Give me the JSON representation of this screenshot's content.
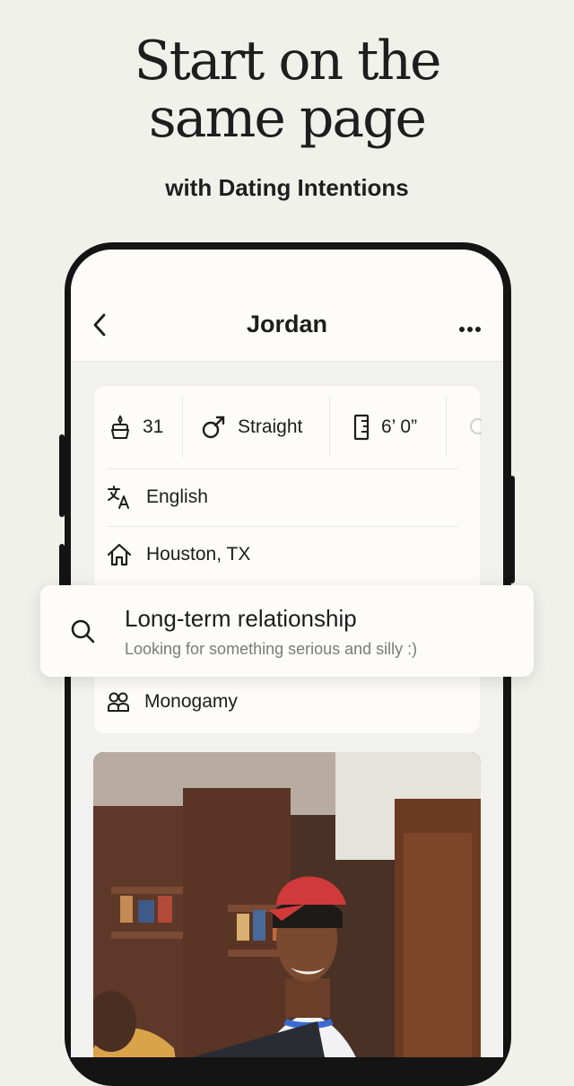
{
  "headline": {
    "line1": "Start on the",
    "line2": "same page"
  },
  "subhead": "with Dating Intentions",
  "profile": {
    "name": "Jordan",
    "vitals": [
      {
        "icon": "cake-icon",
        "value": "31"
      },
      {
        "icon": "orientation-icon",
        "value": "Straight"
      },
      {
        "icon": "ruler-icon",
        "value": "6’ 0”"
      }
    ],
    "language": "English",
    "location": "Houston, TX",
    "relationship_type": "Monogamy"
  },
  "popup": {
    "icon": "search-icon",
    "title": "Long-term relationship",
    "subtitle": "Looking for something serious and silly :)"
  },
  "colors": {
    "background": "#f1f1ec",
    "card": "#fdfcfa",
    "phone_frame": "#141414"
  }
}
